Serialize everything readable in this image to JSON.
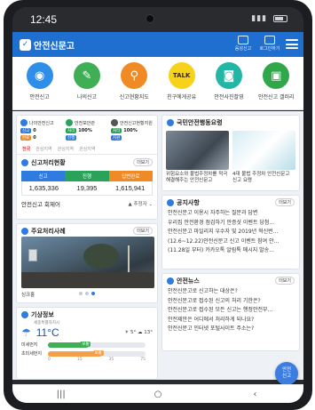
{
  "status_bar": {
    "time": "12:45"
  },
  "header": {
    "app_name": "안전신문고",
    "btn_voice": "음성신고",
    "btn_login": "로그인하기"
  },
  "quick_menu": [
    {
      "label": "안전신고",
      "icon": "siren-icon",
      "color": "#2f8ee8"
    },
    {
      "label": "나의신고",
      "icon": "pencil-icon",
      "color": "#3fae55"
    },
    {
      "label": "신고현황지도",
      "icon": "map-pin-icon",
      "color": "#f08a24"
    },
    {
      "label": "친구에게공유",
      "icon": "talk-icon",
      "color": "#f6d21b"
    },
    {
      "label": "안전사진촬영",
      "icon": "camera-icon",
      "color": "#22b6a5"
    },
    {
      "label": "안전신고 갤러리",
      "icon": "gallery-icon",
      "color": "#2fa84a"
    }
  ],
  "stats": [
    {
      "name": "나의안전신고",
      "line1_chip": "신고",
      "line1_val": "0",
      "line2_chip": "완료",
      "line2_val": "0"
    },
    {
      "name": "안전보안관",
      "line1_chip": "처리",
      "line1_val": "100%",
      "line2_chip": "진행",
      "line2_val": ""
    },
    {
      "name": "안전신고현황지원",
      "line1_chip": "처리",
      "line1_val": "100%",
      "line2_chip": "지원",
      "line2_val": ""
    }
  ],
  "tabs": [
    "전국",
    "관심지역",
    "관심지역",
    "관심지역"
  ],
  "report_status": {
    "title": "신고처리현황",
    "more": "더보기",
    "headers": [
      "신고",
      "진행",
      "답변완료"
    ],
    "values": [
      "1,635,336",
      "19,395",
      "1,615,941"
    ]
  },
  "meeting": {
    "title": "안전신고 회제어",
    "select": "추정자"
  },
  "cases": {
    "title": "주요처리사례",
    "more": "더보기",
    "caption": "싱크홀"
  },
  "weather": {
    "title": "기상정보",
    "location": "세종특별자치시",
    "temp": "11°C",
    "high": "5°",
    "low": "13°",
    "dust_label": "미세먼지",
    "dust_tag": "보통",
    "dust_level": 0.42,
    "fine_dust_label": "초미세먼지",
    "fine_dust_tag": "보통",
    "fine_dust_level": 0.55,
    "scale": [
      "0",
      "15",
      "35",
      "75"
    ]
  },
  "videos": {
    "title": "국민안전행동요령",
    "items": [
      {
        "caption": "위험요소와 불법주정차를 적극 해결해주는 안전신문고"
      },
      {
        "caption": "4대 불법 주정차 안전신문고 신고 요령"
      }
    ]
  },
  "notices": {
    "title": "공지사항",
    "more": "더보기",
    "items": [
      "안전신문고 이용시 자주하는 질문과 답변",
      "우리집 안전환경 점검하기 안증샷 이벤트 당첨...",
      "안전신문고 마일리지 우수자 및 2019년 혁신번...",
      "(12.6~12.22)안전신문고 신고 이벤트 참여 안...",
      "(11.28일 부터) 카카오톡 알림톡 메시지 발송..."
    ]
  },
  "news": {
    "title": "안전뉴스",
    "more": "더보기",
    "items": [
      "안전신문고로 신고하는 대상은?",
      "안전신문고로 접수된 신고의 처리 기한은?",
      "안전신문고로 접수된 모든 신고는 행정안전부...",
      "안전제안은 어디에서 처리하게 되나요?",
      "안전신문고 인터넷 포털사이트 주소는?"
    ]
  },
  "fab": {
    "line1": "안전",
    "line2": "신고"
  },
  "navbar": {
    "recents": "|||",
    "home": "○",
    "back": "‹"
  },
  "colors": {
    "brand": "#1f6fd1",
    "report": "#2f7be0",
    "progress": "#29a35a",
    "done": "#f08a24"
  }
}
